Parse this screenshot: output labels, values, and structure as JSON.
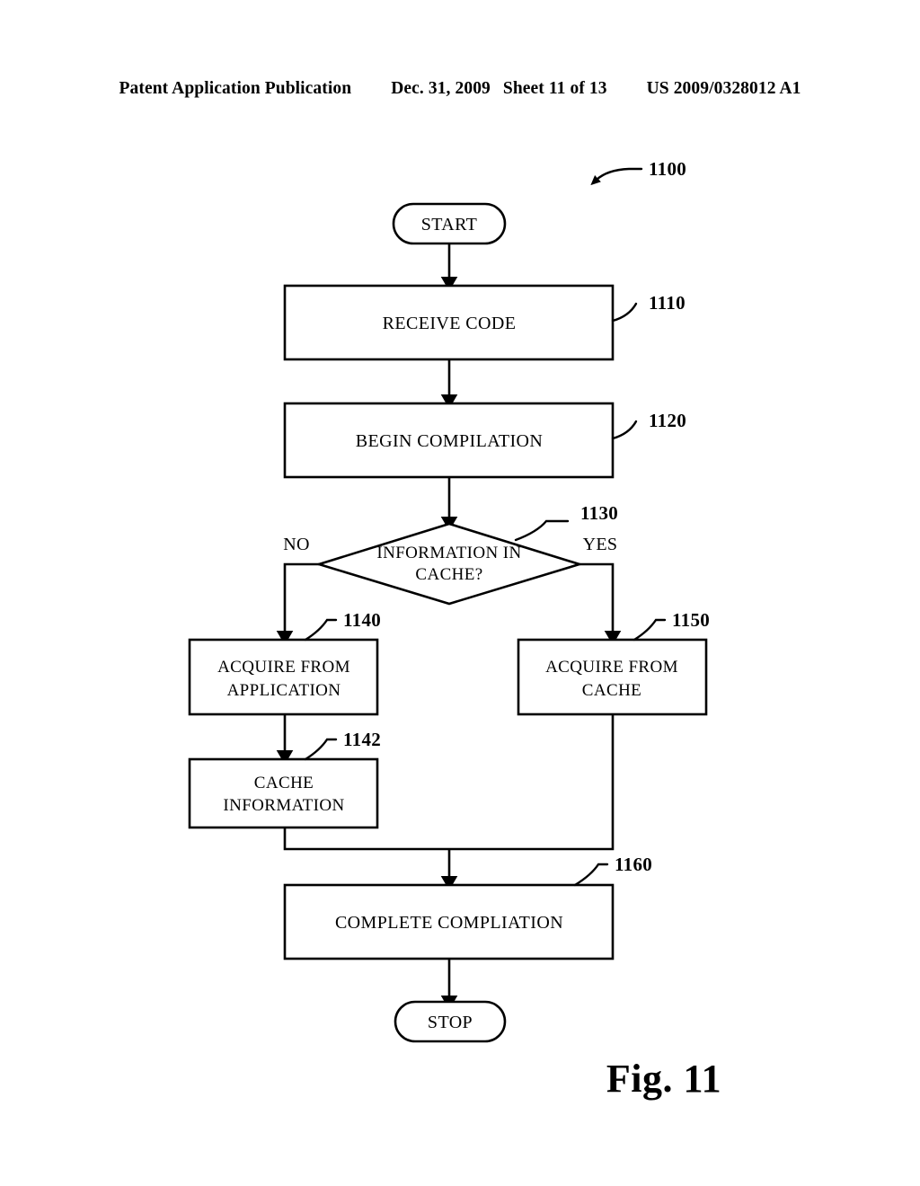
{
  "header": {
    "publication": "Patent Application Publication",
    "date": "Dec. 31, 2009",
    "sheet": "Sheet 11 of 13",
    "document_number": "US 2009/0328012 A1"
  },
  "figure": {
    "caption": "Fig. 11",
    "diagram_reference": "1100"
  },
  "nodes": {
    "start": {
      "label": "START"
    },
    "receive_code": {
      "label": "RECEIVE CODE",
      "ref": "1110"
    },
    "begin_compilation": {
      "label": "BEGIN COMPILATION",
      "ref": "1120"
    },
    "decision": {
      "line1": "INFORMATION IN",
      "line2": "CACHE?",
      "ref": "1130",
      "branch_no": "NO",
      "branch_yes": "YES"
    },
    "acquire_from_application": {
      "line1": "ACQUIRE FROM",
      "line2": "APPLICATION",
      "ref": "1140"
    },
    "acquire_from_cache": {
      "line1": "ACQUIRE FROM",
      "line2": "CACHE",
      "ref": "1150"
    },
    "cache_information": {
      "line1": "CACHE",
      "line2": "INFORMATION",
      "ref": "1142"
    },
    "complete_compilation": {
      "label": "COMPLETE COMPLIATION",
      "ref": "1160"
    },
    "stop": {
      "label": "STOP"
    }
  },
  "colors": {
    "ink": "#000000",
    "paper": "#ffffff"
  }
}
